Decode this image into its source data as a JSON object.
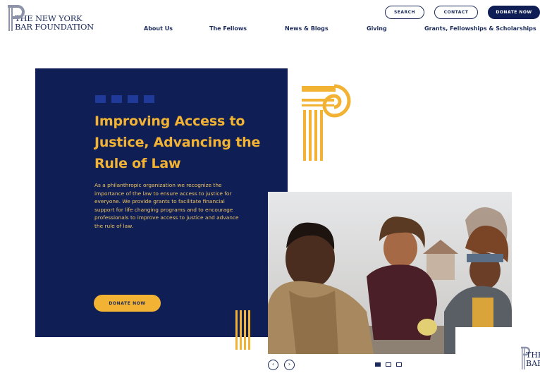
{
  "header": {
    "logo_line1": "THE NEW YORK",
    "logo_line2": "BAR FOUNDATION",
    "search_label": "SEARCH",
    "contact_label": "CONTACT",
    "donate_label": "DONATE NOW"
  },
  "nav": {
    "items": [
      {
        "label": "About Us"
      },
      {
        "label": "The Fellows"
      },
      {
        "label": "News & Blogs"
      },
      {
        "label": "Giving"
      },
      {
        "label": "Grants, Fellowships & Scholarships"
      }
    ]
  },
  "hero": {
    "title": "Improving Access to Justice, Advancing the Rule of Law",
    "body": "As a philanthropic organization we recognize the importance of the law to ensure access to justice for everyone. We provide grants to facilitate financial support for life changing programs and to encourage professionals to improve access to justice and advance the rule of law.",
    "donate_label": "DONATE NOW"
  },
  "carousel": {
    "prev_icon": "chevron-left-icon",
    "next_icon": "chevron-right-icon",
    "slide_count": 3,
    "active_slide": 1
  },
  "corner_logo": {
    "line1": "THE",
    "line2": "BAR"
  },
  "colors": {
    "navy": "#0f1f55",
    "gold": "#f2b233"
  }
}
